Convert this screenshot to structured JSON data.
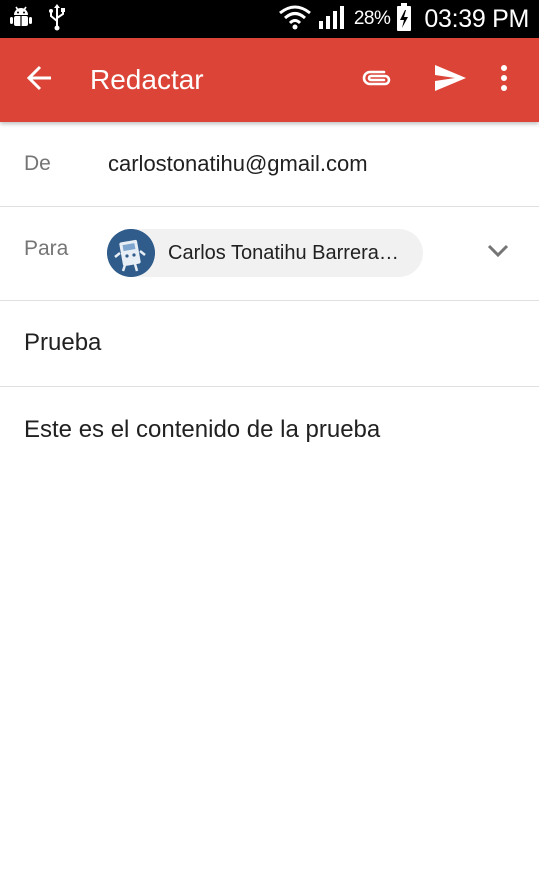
{
  "status_bar": {
    "battery_percent": "28%",
    "time": "03:39 PM",
    "icons": [
      "android-debug-icon",
      "usb-icon",
      "wifi-icon",
      "signal-icon",
      "battery-charging-icon"
    ]
  },
  "app_bar": {
    "title": "Redactar",
    "background_color": "#db4437",
    "icons": [
      "back-arrow-icon",
      "attach-icon",
      "send-icon",
      "more-vert-icon"
    ]
  },
  "compose": {
    "from": {
      "label": "De",
      "value": "carlostonatihu@gmail.com"
    },
    "to": {
      "label": "Para",
      "recipient_name": "Carlos Tonatihu Barrera…"
    },
    "subject": {
      "value": "Prueba"
    },
    "body": {
      "value": "Este es el contenido de la prueba"
    }
  }
}
